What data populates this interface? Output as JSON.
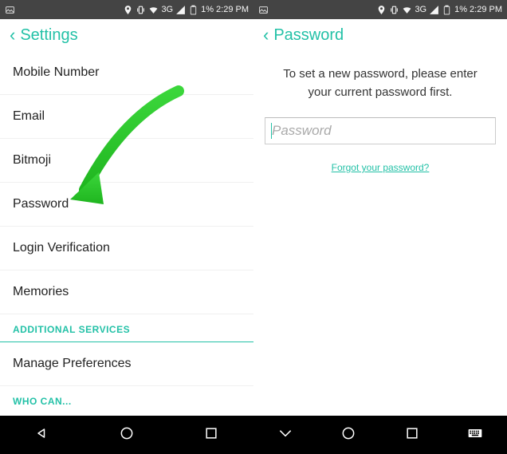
{
  "statusbar": {
    "network": "3G",
    "battery": "1%",
    "time": "2:29 PM"
  },
  "left": {
    "title": "Settings",
    "items": [
      "Mobile Number",
      "Email",
      "Bitmoji",
      "Password",
      "Login Verification",
      "Memories"
    ],
    "section1": "ADDITIONAL SERVICES",
    "manage": "Manage Preferences",
    "section2": "WHO CAN..."
  },
  "right": {
    "title": "Password",
    "instruction": "To set a new password, please enter your current password first.",
    "placeholder": "Password",
    "forgot": "Forgot your password?"
  }
}
